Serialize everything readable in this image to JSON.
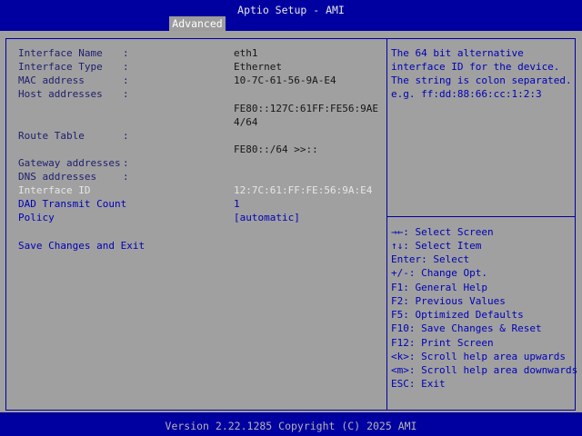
{
  "header": {
    "title": "Aptio Setup - AMI",
    "tabs": [
      {
        "label": "Advanced",
        "active": true
      }
    ]
  },
  "settings": [
    {
      "label": "Interface Name",
      "value": "eth1",
      "interactable": false
    },
    {
      "label": "Interface Type",
      "value": "Ethernet",
      "interactable": false
    },
    {
      "label": "MAC address",
      "value": "10-7C-61-56-9A-E4",
      "interactable": false
    },
    {
      "label": "Host addresses",
      "value_lines": [
        "FE80::127C:61FF:FE56:9AE",
        "4/64"
      ],
      "interactable": false
    },
    {
      "label": "Route Table",
      "value": "FE80::/64 >>::",
      "interactable": false
    },
    {
      "label": "Gateway addresses",
      "value": "",
      "interactable": false
    },
    {
      "label": "DNS addresses",
      "value": "",
      "interactable": false
    },
    {
      "label": "Interface ID",
      "value": "12:7C:61:FF:FE:56:9A:E4",
      "interactable": true,
      "selected": true
    },
    {
      "label": "DAD Transmit Count",
      "value": "1",
      "interactable": true
    },
    {
      "label": "Policy",
      "value": "[automatic]",
      "interactable": true
    }
  ],
  "colon": ":",
  "actions": {
    "save_exit": "Save Changes and Exit"
  },
  "help": {
    "description": [
      "The 64 bit alternative",
      "interface ID for the device.",
      "The string is colon separated.",
      "e.g. ff:dd:88:66:cc:1:2:3"
    ],
    "keys": [
      "→←: Select Screen",
      "↑↓: Select Item",
      "Enter: Select",
      "+/-: Change Opt.",
      "F1: General Help",
      "F2: Previous Values",
      "F5: Optimized Defaults",
      "F10: Save Changes & Reset",
      "F12: Print Screen",
      "<k>: Scroll help area upwards",
      "<m>: Scroll help area downwards",
      "ESC: Exit"
    ]
  },
  "footer": {
    "version": "Version 2.22.1285 Copyright (C) 2025 AMI"
  },
  "colors": {
    "background": "#000099",
    "panel": "#a0a0a0",
    "accent_blue": "#0000b8",
    "selected_text": "#e6e6e6"
  }
}
